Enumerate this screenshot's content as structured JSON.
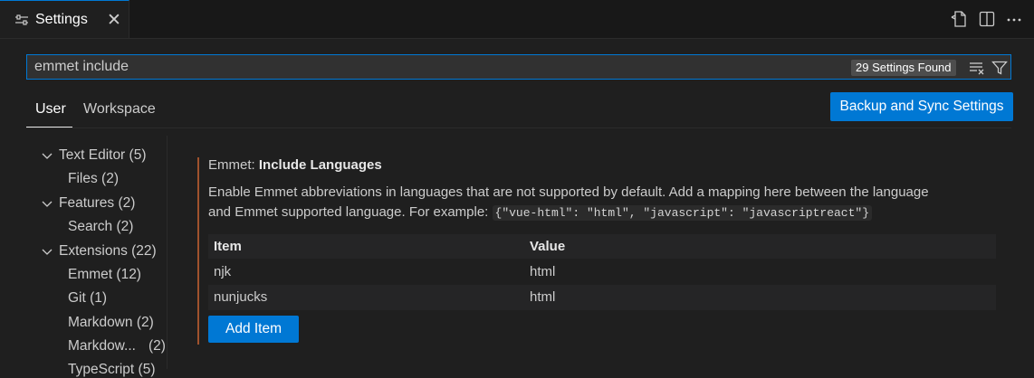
{
  "tab": {
    "title": "Settings",
    "close": "✕"
  },
  "search": {
    "value": "emmet include",
    "count": "29 Settings Found"
  },
  "scopes": {
    "user": "User",
    "workspace": "Workspace"
  },
  "sync_button": "Backup and Sync Settings",
  "tree": [
    {
      "label": "Text Editor",
      "count": "(5)",
      "expanded": true
    },
    {
      "label": "Files",
      "count": "(2)"
    },
    {
      "label": "Features",
      "count": "(2)",
      "expanded": true
    },
    {
      "label": "Search",
      "count": "(2)"
    },
    {
      "label": "Extensions",
      "count": "(22)",
      "expanded": true
    },
    {
      "label": "Emmet",
      "count": "(12)"
    },
    {
      "label": "Git",
      "count": "(1)"
    },
    {
      "label": "Markdown",
      "count": "(2)"
    },
    {
      "label": "Markdow...",
      "count": "(2)"
    },
    {
      "label": "TypeScript",
      "count": "(5)"
    }
  ],
  "setting": {
    "category": "Emmet:",
    "name": "Include Languages",
    "description_line1": "Enable Emmet abbreviations in languages that are not supported by default. Add a mapping here between the language",
    "description_line2": "and Emmet supported language. For example:",
    "example_code": "{\"vue-html\": \"html\", \"javascript\": \"javascriptreact\"}",
    "table": {
      "headers": [
        "Item",
        "Value"
      ],
      "rows": [
        {
          "item": "njk",
          "value": "html"
        },
        {
          "item": "nunjucks",
          "value": "html"
        }
      ]
    },
    "add_button": "Add Item"
  },
  "colors": {
    "accent": "#0078d4",
    "modified_bar": "#a0522d",
    "background": "#1f1f1f"
  }
}
